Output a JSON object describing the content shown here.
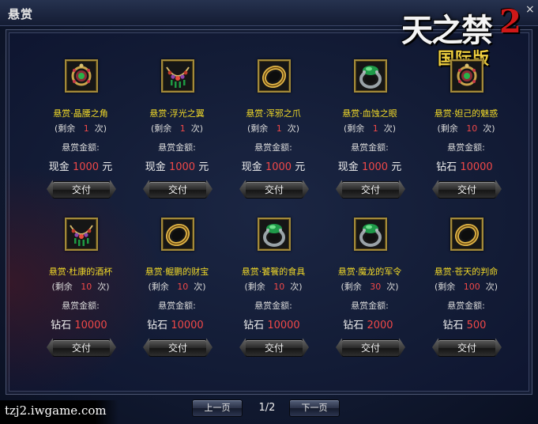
{
  "window": {
    "title": "悬赏"
  },
  "logo": {
    "main": "天之禁",
    "number": "2",
    "sub": "国际版",
    "close": "×"
  },
  "bounties": [
    {
      "name": "悬赏·晶腰之角",
      "remain": "1",
      "currency": "现金",
      "amount": "1000",
      "unit": "元",
      "icon": "pendant-icon"
    },
    {
      "name": "悬赏·浮光之翼",
      "remain": "1",
      "currency": "现金",
      "amount": "1000",
      "unit": "元",
      "icon": "necklace-icon"
    },
    {
      "name": "悬赏·浑邪之爪",
      "remain": "1",
      "currency": "现金",
      "amount": "1000",
      "unit": "元",
      "icon": "gold-ring-icon"
    },
    {
      "name": "悬赏·血蚀之眼",
      "remain": "1",
      "currency": "现金",
      "amount": "1000",
      "unit": "元",
      "icon": "jade-ring-icon"
    },
    {
      "name": "悬赏·妲己的魅惑",
      "remain": "10",
      "currency": "钻石",
      "amount": "10000",
      "unit": "",
      "icon": "pendant-icon"
    },
    {
      "name": "悬赏·杜康的酒杯",
      "remain": "10",
      "currency": "钻石",
      "amount": "10000",
      "unit": "",
      "icon": "necklace-icon"
    },
    {
      "name": "悬赏·鲲鹏的财宝",
      "remain": "10",
      "currency": "钻石",
      "amount": "10000",
      "unit": "",
      "icon": "gold-ring-icon"
    },
    {
      "name": "悬赏·饕餮的食具",
      "remain": "10",
      "currency": "钻石",
      "amount": "10000",
      "unit": "",
      "icon": "jade-ring-icon"
    },
    {
      "name": "悬赏·魔龙的军令",
      "remain": "30",
      "currency": "钻石",
      "amount": "2000",
      "unit": "",
      "icon": "jade-ring-icon"
    },
    {
      "name": "悬赏·苍天的判命",
      "remain": "100",
      "currency": "钻石",
      "amount": "500",
      "unit": "",
      "icon": "gold-ring-icon"
    }
  ],
  "labels": {
    "remain_prefix": "剩余",
    "remain_suffix": "次",
    "amount_label": "悬赏金额:",
    "submit": "交付"
  },
  "pagination": {
    "prev": "上一页",
    "page": "1/2",
    "next": "下一页"
  },
  "watermark": "tzj2.iwgame.com"
}
